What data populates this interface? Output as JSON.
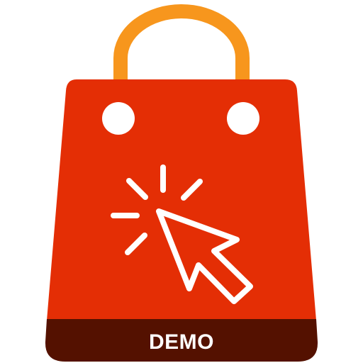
{
  "logo": {
    "name": "shopping-bag-click-demo",
    "label": "DEMO",
    "colors": {
      "handle": "#F7961D",
      "bag": "#E42E05",
      "band": "#541100",
      "holes": "#FFFFFF",
      "cursor": "#FFFFFF",
      "label_text": "#FFFFFF"
    },
    "icons": [
      "shopping-bag-icon",
      "cursor-click-icon"
    ]
  }
}
